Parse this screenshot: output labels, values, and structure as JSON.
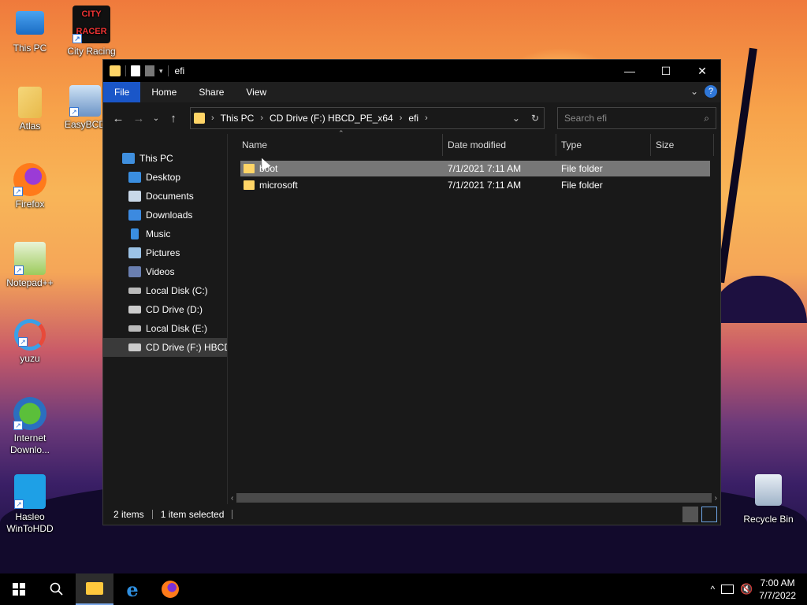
{
  "desktop": {
    "icons": [
      {
        "label": "This PC",
        "icon": "computer-icon"
      },
      {
        "label": "City Racing",
        "icon": "city-racing-icon"
      },
      {
        "label": "Atlas",
        "icon": "atlas-icon"
      },
      {
        "label": "EasyBCD",
        "icon": "easybcd-icon"
      },
      {
        "label": "Firefox",
        "icon": "firefox-icon"
      },
      {
        "label": "Notepad++",
        "icon": "notepadpp-icon"
      },
      {
        "label": "yuzu",
        "icon": "yuzu-icon"
      },
      {
        "label": "Internet Downlo...",
        "icon": "idm-icon"
      },
      {
        "label": "Hasleo WinToHDD",
        "icon": "wintohdd-icon"
      },
      {
        "label": "Recycle Bin",
        "icon": "recycle-bin-icon"
      }
    ],
    "icon_city_racing_text": "CITY RACER"
  },
  "window": {
    "title": "efi",
    "controls": {
      "minimize": "—",
      "maximize": "☐",
      "close": "✕"
    },
    "ribbon_tabs": [
      "File",
      "Home",
      "Share",
      "View"
    ],
    "help_label": "?",
    "address": {
      "crumbs": [
        "This PC",
        "CD Drive (F:) HBCD_PE_x64",
        "efi"
      ]
    },
    "search": {
      "placeholder": "Search efi"
    },
    "nav_pane": [
      {
        "label": "This PC",
        "icon": "computer-icon"
      },
      {
        "label": "Desktop",
        "icon": "desktop-icon"
      },
      {
        "label": "Documents",
        "icon": "documents-icon"
      },
      {
        "label": "Downloads",
        "icon": "downloads-icon"
      },
      {
        "label": "Music",
        "icon": "music-icon"
      },
      {
        "label": "Pictures",
        "icon": "pictures-icon"
      },
      {
        "label": "Videos",
        "icon": "videos-icon"
      },
      {
        "label": "Local Disk (C:)",
        "icon": "drive-icon"
      },
      {
        "label": "CD Drive (D:)",
        "icon": "cd-drive-icon"
      },
      {
        "label": "Local Disk (E:)",
        "icon": "drive-icon"
      },
      {
        "label": "CD Drive (F:) HBCD_",
        "icon": "cd-drive-icon"
      }
    ],
    "columns": [
      "Name",
      "Date modified",
      "Type",
      "Size"
    ],
    "files": [
      {
        "name": "boot",
        "date": "7/1/2021 7:11 AM",
        "type": "File folder",
        "size": ""
      },
      {
        "name": "microsoft",
        "date": "7/1/2021 7:11 AM",
        "type": "File folder",
        "size": ""
      }
    ],
    "status": {
      "items": "2 items",
      "selected": "1 item selected"
    }
  },
  "taskbar": {
    "time": "7:00 AM",
    "date": "7/7/2022",
    "tray_expand": "^"
  },
  "colors": {
    "accent": "#1a56c8",
    "folder": "#ffd567",
    "selection": "#777777"
  }
}
